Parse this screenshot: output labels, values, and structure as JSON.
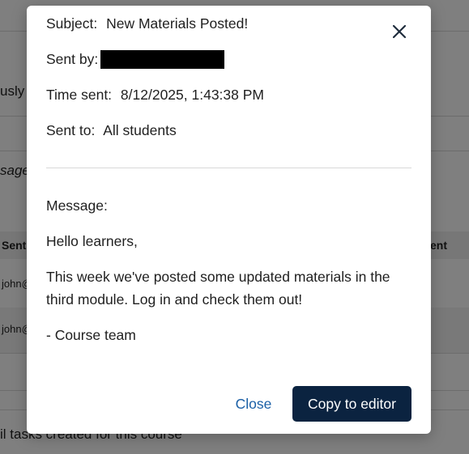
{
  "background": {
    "fragment_1": "usly",
    "fragment_2": "sage",
    "col_sent": "Sent",
    "col_right": "ent",
    "row1_cell": "john@",
    "row2_cell": "john@",
    "footer_text": "il tasks created for this course"
  },
  "modal": {
    "close_icon": "close-x-icon",
    "subject_label": "Subject:",
    "subject_value": "New Materials Posted!",
    "sent_by_label": "Sent by:",
    "sent_by_value": "[redacted]",
    "time_sent_label": "Time sent:",
    "time_sent_value": "8/12/2025, 1:43:38 PM",
    "sent_to_label": "Sent to:",
    "sent_to_value": "All students",
    "message_label": "Message:",
    "message_lines": [
      "Hello learners,",
      "This week we've posted some updated materials in the third module. Log in and check them out!",
      "- Course team"
    ],
    "close_button": "Close",
    "copy_button": "Copy to editor"
  },
  "colors": {
    "primary_button_bg": "#0b2340",
    "link": "#1a5fa6"
  }
}
